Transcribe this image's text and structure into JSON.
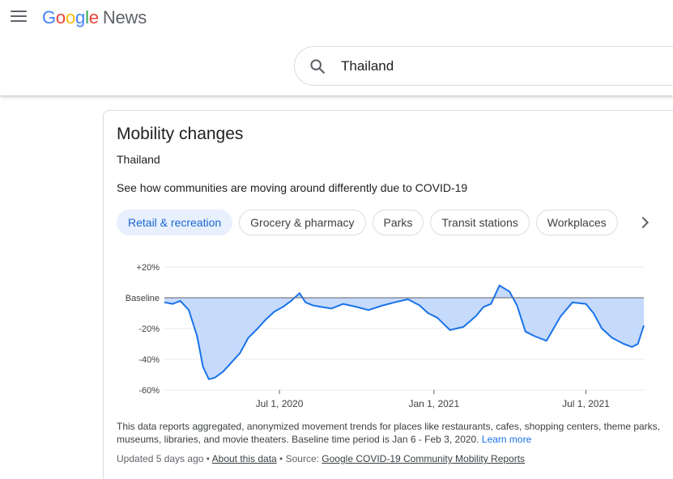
{
  "header": {
    "logo_letters": [
      "G",
      "o",
      "o",
      "g",
      "l",
      "e"
    ],
    "logo_news": "News",
    "search_value": "Thailand",
    "colors": {
      "blue": "#4285f4",
      "red": "#ea4335",
      "yellow": "#fbbc05",
      "green": "#34a853"
    }
  },
  "card": {
    "title": "Mobility changes",
    "subtitle": "Thailand",
    "description": "See how communities are moving around differently due to COVID-19",
    "chips": [
      {
        "label": "Retail & recreation",
        "active": true
      },
      {
        "label": "Grocery & pharmacy",
        "active": false
      },
      {
        "label": "Parks",
        "active": false
      },
      {
        "label": "Transit stations",
        "active": false
      },
      {
        "label": "Workplaces",
        "active": false
      }
    ],
    "footnote": "This data reports aggregated, anonymized movement trends for places like restaurants, cafes, shopping centers, theme parks, museums, libraries, and movie theaters. Baseline time period is Jan 6 - Feb 3, 2020.",
    "learn_more": "Learn more",
    "updated": "Updated 5 days ago",
    "about_link": "About this data",
    "source_prefix": "Source:",
    "source_link": "Google COVID-19 Community Mobility Reports",
    "separator": "•"
  },
  "chart_data": {
    "type": "area",
    "series": [
      {
        "x": [
          "2020-02-15",
          "2020-02-25",
          "2020-03-05",
          "2020-03-15",
          "2020-03-25",
          "2020-04-01",
          "2020-04-08",
          "2020-04-15",
          "2020-04-25",
          "2020-05-05",
          "2020-05-15",
          "2020-05-25",
          "2020-06-05",
          "2020-06-15",
          "2020-06-25",
          "2020-07-05",
          "2020-07-15",
          "2020-07-25",
          "2020-08-01",
          "2020-08-10",
          "2020-08-20",
          "2020-09-01",
          "2020-09-15",
          "2020-10-01",
          "2020-10-15",
          "2020-11-01",
          "2020-11-15",
          "2020-12-01",
          "2020-12-15",
          "2020-12-25",
          "2021-01-05",
          "2021-01-20",
          "2021-02-05",
          "2021-02-20",
          "2021-03-01",
          "2021-03-10",
          "2021-03-20",
          "2021-04-01",
          "2021-04-10",
          "2021-04-20",
          "2021-05-01",
          "2021-05-15",
          "2021-06-01",
          "2021-06-15",
          "2021-07-01",
          "2021-07-10",
          "2021-07-20",
          "2021-08-01",
          "2021-08-15",
          "2021-08-25",
          "2021-09-01",
          "2021-09-08"
        ],
        "y": [
          -3,
          -4,
          -2,
          -8,
          -25,
          -45,
          -53,
          -52,
          -48,
          -42,
          -36,
          -26,
          -20,
          -14,
          -9,
          -6,
          -2,
          3,
          -3,
          -5,
          -6,
          -7,
          -4,
          -6,
          -8,
          -5,
          -3,
          -1,
          -5,
          -10,
          -13,
          -21,
          -19,
          -12,
          -6,
          -4,
          8,
          4,
          -5,
          -22,
          -25,
          -28,
          -12,
          -3,
          -4,
          -10,
          -20,
          -26,
          -30,
          -32,
          -30,
          -18
        ]
      }
    ],
    "ylim": [
      -60,
      20
    ],
    "yticks": [
      20,
      0,
      -20,
      -40,
      -60
    ],
    "yticklabels": [
      "+20%",
      "Baseline",
      "-20%",
      "-40%",
      "-60%"
    ],
    "xticks": [
      "2020-07-01",
      "2021-01-01",
      "2021-07-01"
    ],
    "xticklabels": [
      "Jul 1, 2020",
      "Jan 1, 2021",
      "Jul 1, 2021"
    ],
    "xlim": [
      "2020-02-15",
      "2021-09-08"
    ],
    "grid": true,
    "line_color": "#1a73e8",
    "fill_color": "#c6dafc",
    "baseline_color": "#5f6368",
    "grid_color": "#e8eaed"
  }
}
